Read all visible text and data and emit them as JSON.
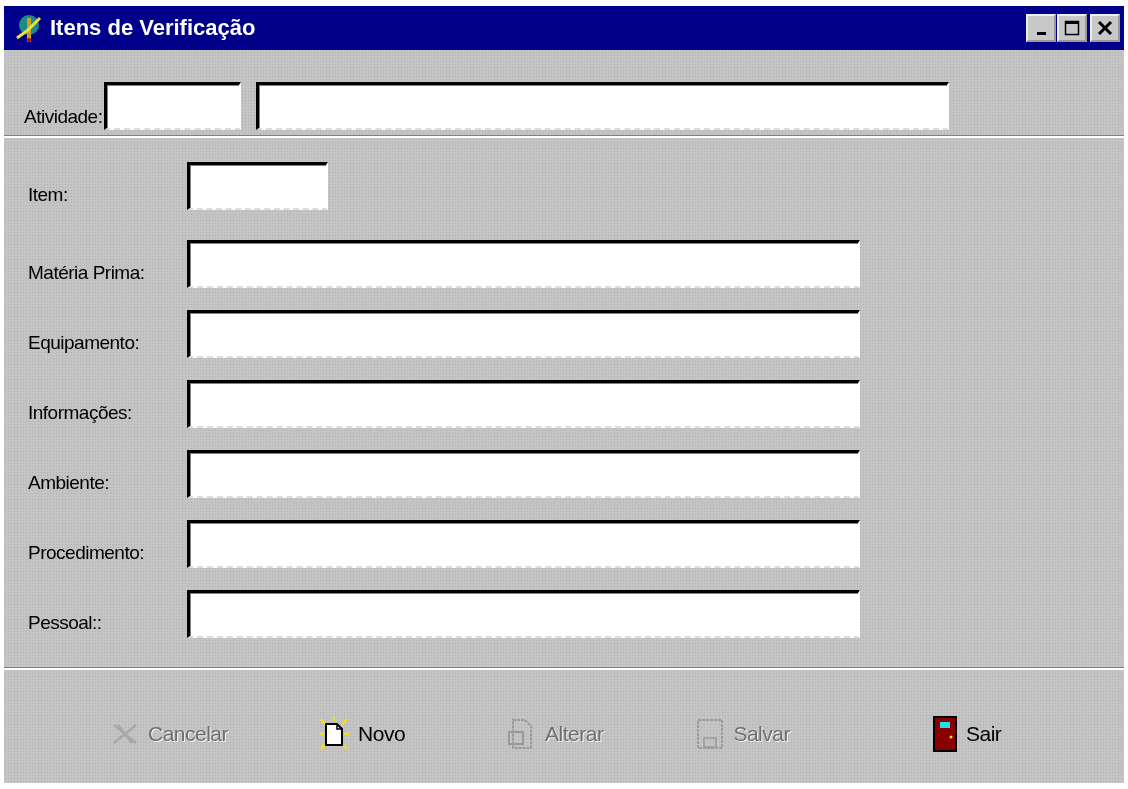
{
  "window": {
    "title": "Itens de Verificação"
  },
  "activity": {
    "label": "Atividade:"
  },
  "fields": [
    {
      "label": "Item:",
      "kind": "short"
    },
    {
      "label": "Matéria Prima:",
      "kind": "long"
    },
    {
      "label": "Equipamento:",
      "kind": "long"
    },
    {
      "label": "Informações:",
      "kind": "long"
    },
    {
      "label": "Ambiente:",
      "kind": "long"
    },
    {
      "label": "Procedimento:",
      "kind": "long"
    },
    {
      "label": "Pessoal::",
      "kind": "long"
    }
  ],
  "buttons": [
    {
      "label": "Cancelar",
      "kind": "cancel",
      "disabled": true
    },
    {
      "label": "Novo",
      "kind": "new",
      "disabled": false
    },
    {
      "label": "Alterar",
      "kind": "edit",
      "disabled": true
    },
    {
      "label": "Salvar",
      "kind": "save",
      "disabled": true
    },
    {
      "label": "Sair",
      "kind": "exit",
      "disabled": false
    }
  ]
}
